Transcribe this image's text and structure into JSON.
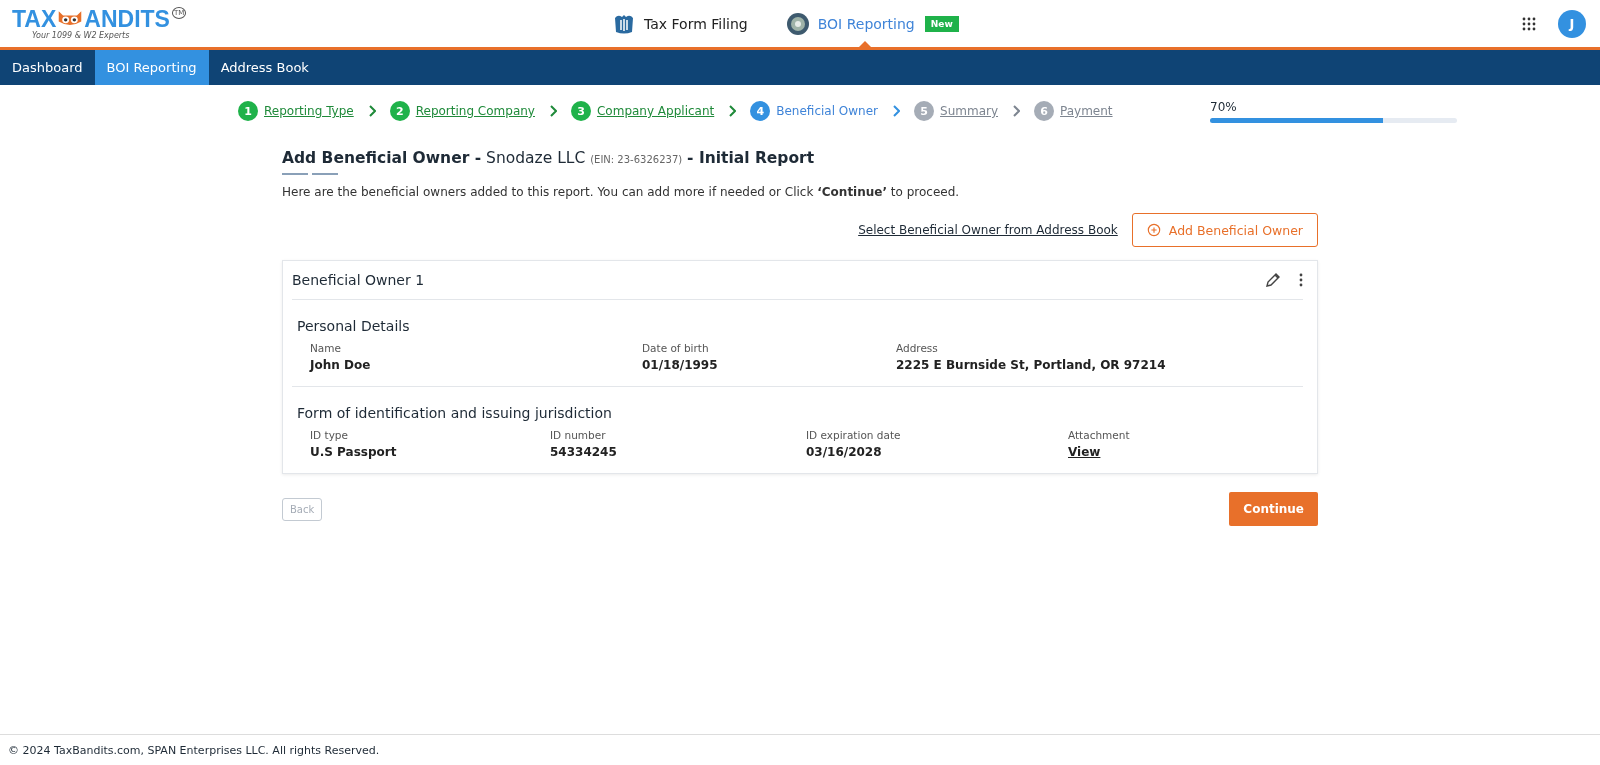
{
  "logo": {
    "left": "TAX",
    "right": "ANDITS",
    "tagline": "Your 1099 & W2 Experts",
    "mark": "TM"
  },
  "products": [
    {
      "label": "Tax Form Filing",
      "selected": false,
      "kind": "irs"
    },
    {
      "label": "BOI Reporting",
      "selected": true,
      "kind": "seal",
      "badge": "New"
    }
  ],
  "avatar": "J",
  "nav": [
    {
      "label": "Dashboard",
      "selected": false
    },
    {
      "label": "BOI Reporting",
      "selected": true
    },
    {
      "label": "Address Book",
      "selected": false
    }
  ],
  "steps": [
    {
      "number": "1",
      "label": "Reporting Type",
      "completed": true,
      "selected": false
    },
    {
      "number": "2",
      "label": "Reporting Company",
      "completed": true,
      "selected": false
    },
    {
      "number": "3",
      "label": "Company Applicant",
      "completed": true,
      "selected": false
    },
    {
      "number": "4",
      "label": "Beneficial Owner",
      "completed": false,
      "selected": true
    },
    {
      "number": "5",
      "label": "Summary",
      "completed": false,
      "selected": false
    },
    {
      "number": "6",
      "label": "Payment",
      "completed": false,
      "selected": false
    }
  ],
  "progress": {
    "reading": "70%",
    "level": 0.7
  },
  "heading": {
    "title": "Add Beneficial Owner -",
    "company": "Snodaze LLC",
    "ein": "(EIN: 23-6326237)",
    "suffix": "- Initial Report"
  },
  "intro": "Here are the beneficial owners added to this report. You can add more if needed or Click **‘Continue’** to proceed.",
  "select_link": "Select Beneficial Owner from Address Book",
  "add_button": "Add Beneficial Owner",
  "owner": {
    "title": "Beneficial Owner 1",
    "sections": [
      {
        "title": "Personal Details",
        "fields": [
          {
            "label": "Name",
            "value": "John Doe"
          },
          {
            "label": "Date of birth",
            "value": "01/18/1995"
          },
          {
            "label": "Address",
            "value": "2225 E Burnside St, Portland, OR 97214"
          }
        ]
      },
      {
        "title": "Form of identification and issuing jurisdiction",
        "fields": [
          {
            "label": "ID type",
            "value": "U.S Passport"
          },
          {
            "label": "ID number",
            "value": "54334245"
          },
          {
            "label": "ID expiration date",
            "value": "03/16/2028"
          },
          {
            "label": "Attachment",
            "value": "View",
            "kind": "link"
          }
        ]
      }
    ]
  },
  "back_button": {
    "label": "Back",
    "disabled": true
  },
  "continue_button": "Continue",
  "footer": "© 2024 TaxBandits.com, SPAN Enterprises LLC. All rights Reserved."
}
